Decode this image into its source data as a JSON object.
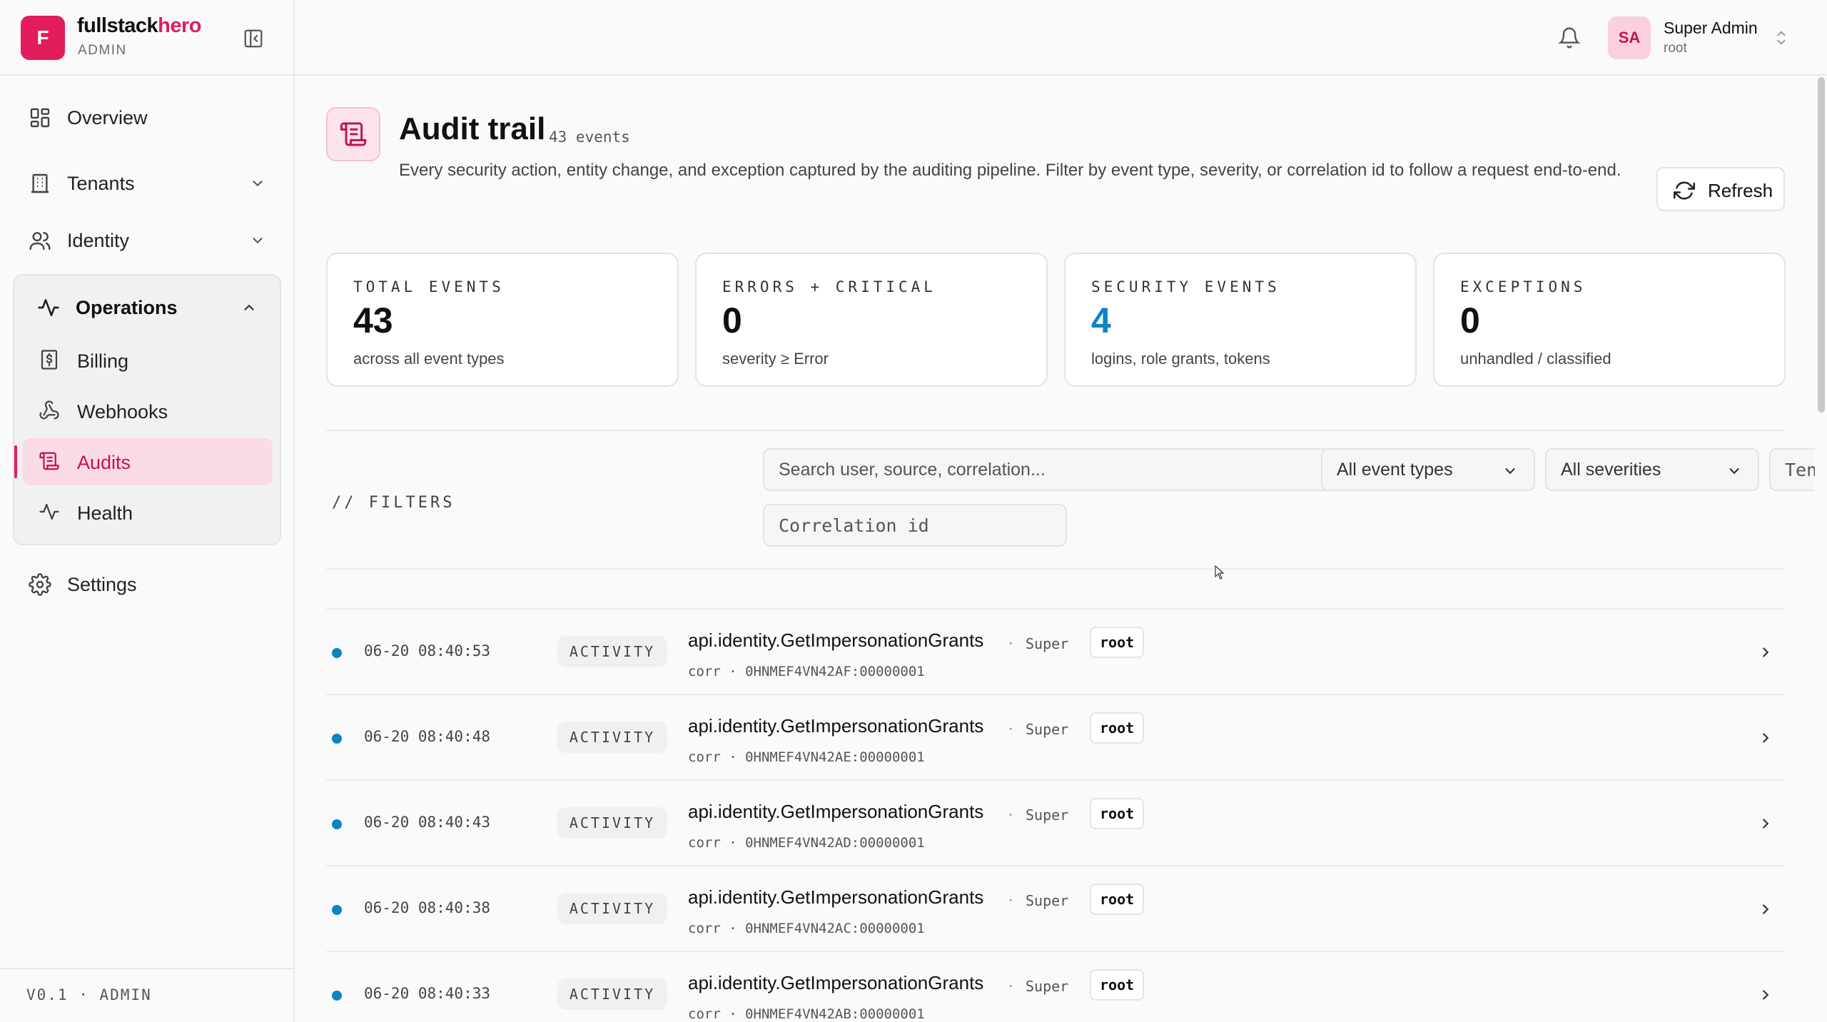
{
  "brand": {
    "name_main": "fullstack",
    "name_accent": "hero",
    "sub": "ADMIN",
    "logo_letter": "F"
  },
  "nav": {
    "overview": "Overview",
    "tenants": "Tenants",
    "identity": "Identity",
    "operations": "Operations",
    "billing": "Billing",
    "webhooks": "Webhooks",
    "audits": "Audits",
    "health": "Health",
    "settings": "Settings"
  },
  "footer": {
    "version": "V0.1 · ADMIN"
  },
  "user": {
    "initials": "SA",
    "name": "Super Admin",
    "role": "root"
  },
  "page": {
    "title": "Audit trail",
    "count": "43 events",
    "description": "Every security action, entity change, and exception captured by the auditing pipeline. Filter by event type, severity, or correlation id to follow a request end-to-end.",
    "refresh_label": "Refresh"
  },
  "stats": [
    {
      "key": "TOTAL EVENTS",
      "value": "43",
      "sub": "across all event types"
    },
    {
      "key": "ERRORS + CRITICAL",
      "value": "0",
      "sub": "severity ≥ Error"
    },
    {
      "key": "SECURITY EVENTS",
      "value": "4",
      "sub": "logins, role grants, tokens"
    },
    {
      "key": "EXCEPTIONS",
      "value": "0",
      "sub": "unhandled / classified"
    }
  ],
  "filters": {
    "label": "// FILTERS",
    "search_placeholder": "Search user, source, correlation...",
    "event_type": "All event types",
    "severity": "All severities",
    "tenant_placeholder": "Tenant id (cross-tenant)",
    "correlation_placeholder": "Correlation id"
  },
  "events": [
    {
      "time": "06-20 08:40:53",
      "type": "ACTIVITY",
      "source": "api.identity.GetImpersonationGrants",
      "sep": "·",
      "user": "Super",
      "tenant": "root",
      "corr": "corr · 0HNMEF4VN42AF:00000001"
    },
    {
      "time": "06-20 08:40:48",
      "type": "ACTIVITY",
      "source": "api.identity.GetImpersonationGrants",
      "sep": "·",
      "user": "Super",
      "tenant": "root",
      "corr": "corr · 0HNMEF4VN42AE:00000001"
    },
    {
      "time": "06-20 08:40:43",
      "type": "ACTIVITY",
      "source": "api.identity.GetImpersonationGrants",
      "sep": "·",
      "user": "Super",
      "tenant": "root",
      "corr": "corr · 0HNMEF4VN42AD:00000001"
    },
    {
      "time": "06-20 08:40:38",
      "type": "ACTIVITY",
      "source": "api.identity.GetImpersonationGrants",
      "sep": "·",
      "user": "Super",
      "tenant": "root",
      "corr": "corr · 0HNMEF4VN42AC:00000001"
    },
    {
      "time": "06-20 08:40:33",
      "type": "ACTIVITY",
      "source": "api.identity.GetImpersonationGrants",
      "sep": "·",
      "user": "Super",
      "tenant": "root",
      "corr": "corr · 0HNMEF4VN42AB:00000001"
    }
  ],
  "colors": {
    "accent": "#e11d5c",
    "info": "#0b84c6"
  }
}
